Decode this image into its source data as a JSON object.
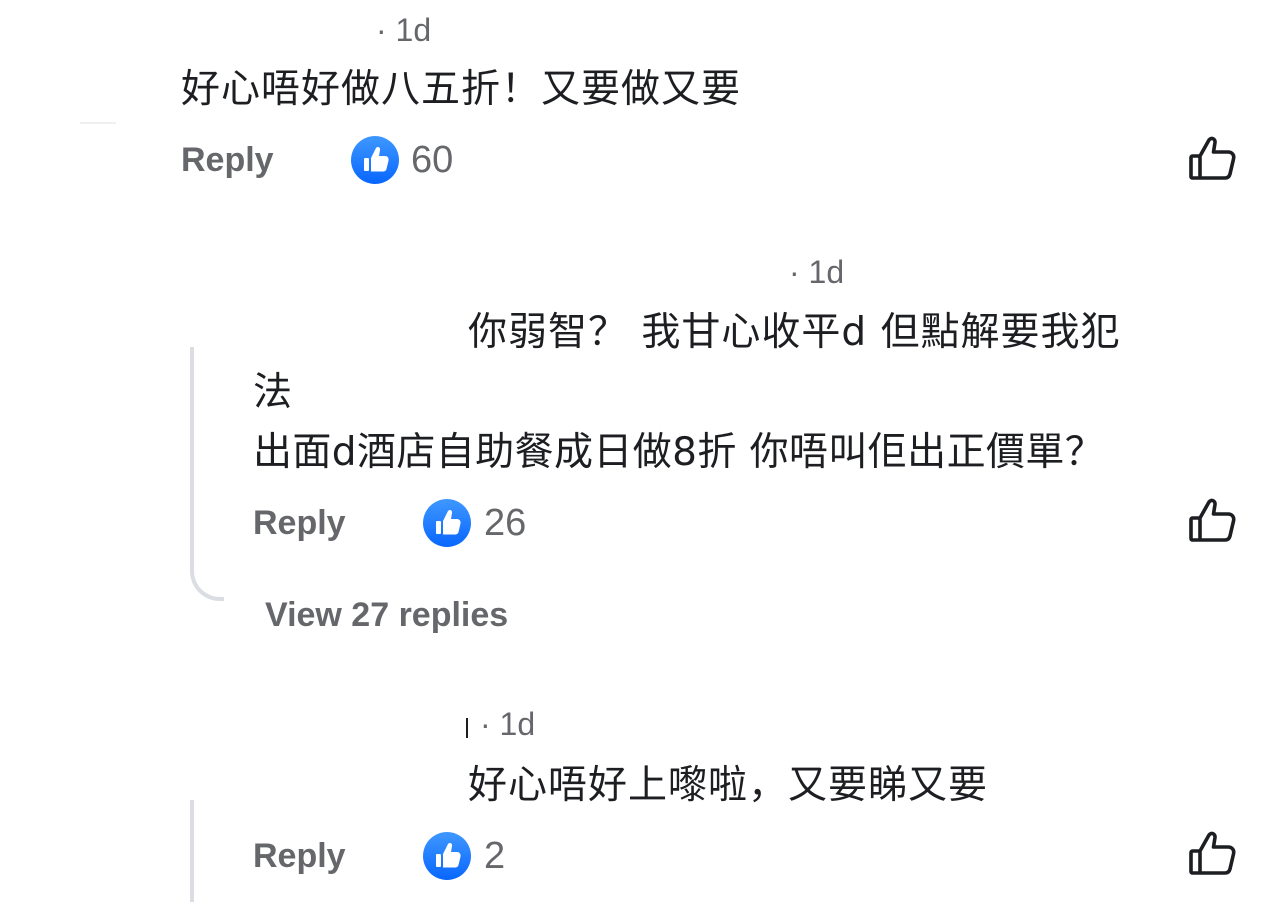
{
  "comments": [
    {
      "time": "· 1d",
      "text_lines": [
        "好心唔好做八五折！又要做又要"
      ],
      "reply_label": "Reply",
      "like_count": "60"
    },
    {
      "time": "· 1d",
      "text_lines": [
        "你弱智？  我甘心收平d  但點解要我犯",
        "法",
        "出面d酒店自助餐成日做8折  你唔叫佢出正價單？"
      ],
      "reply_label": "Reply",
      "like_count": "26",
      "view_replies_label": "View 27 replies"
    },
    {
      "time": "· 1d",
      "text_lines": [
        "好心唔好上嚟啦，又要睇又要"
      ],
      "reply_label": "Reply",
      "like_count": "2"
    }
  ],
  "icons": {
    "like_badge": "thumbs-up-filled-icon",
    "like_button": "thumbs-up-outline-icon"
  },
  "colors": {
    "like_blue": "#0866ff",
    "secondary_text": "#65676b",
    "thread_line": "#dadde1"
  }
}
